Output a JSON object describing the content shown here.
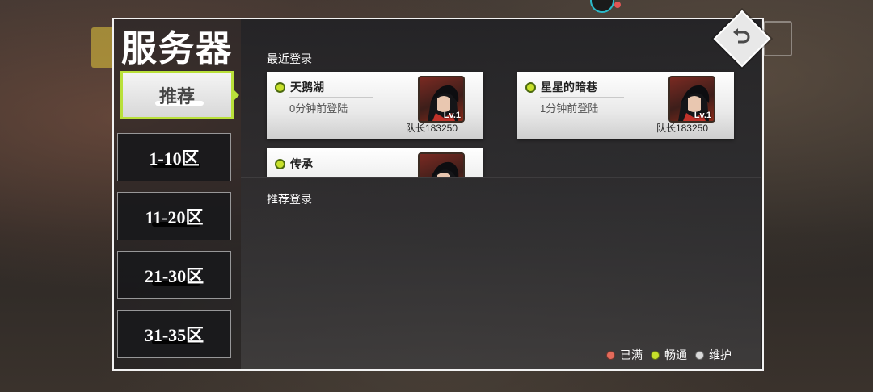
{
  "title": "服务器",
  "tabs": [
    {
      "label": "推荐",
      "active": true
    },
    {
      "label": "1-10区",
      "active": false
    },
    {
      "label": "11-20区",
      "active": false
    },
    {
      "label": "21-30区",
      "active": false
    },
    {
      "label": "31-35区",
      "active": false
    }
  ],
  "recent": {
    "label": "最近登录",
    "servers": [
      {
        "name": "天鹅湖",
        "time": "0分钟前登陆",
        "captain": "队长183250",
        "level": "Lv.1",
        "status_color": "#c7e02b"
      },
      {
        "name": "星星的暗巷",
        "time": "1分钟前登陆",
        "captain": "队长183250",
        "level": "Lv.1",
        "status_color": "#c7e02b"
      },
      {
        "name": "传承",
        "time": "",
        "captain": "",
        "level": "",
        "status_color": "#c7e02b"
      }
    ]
  },
  "recommend": {
    "label": "推荐登录"
  },
  "legend": [
    {
      "label": "已满",
      "color": "#e46a5a"
    },
    {
      "label": "畅通",
      "color": "#c7e02b"
    },
    {
      "label": "维护",
      "color": "#d9d9d9"
    }
  ],
  "colors": {
    "accent": "#b9e03a",
    "frame": "#f2f2f2"
  },
  "icons": {
    "back": "return-arrow-icon"
  }
}
